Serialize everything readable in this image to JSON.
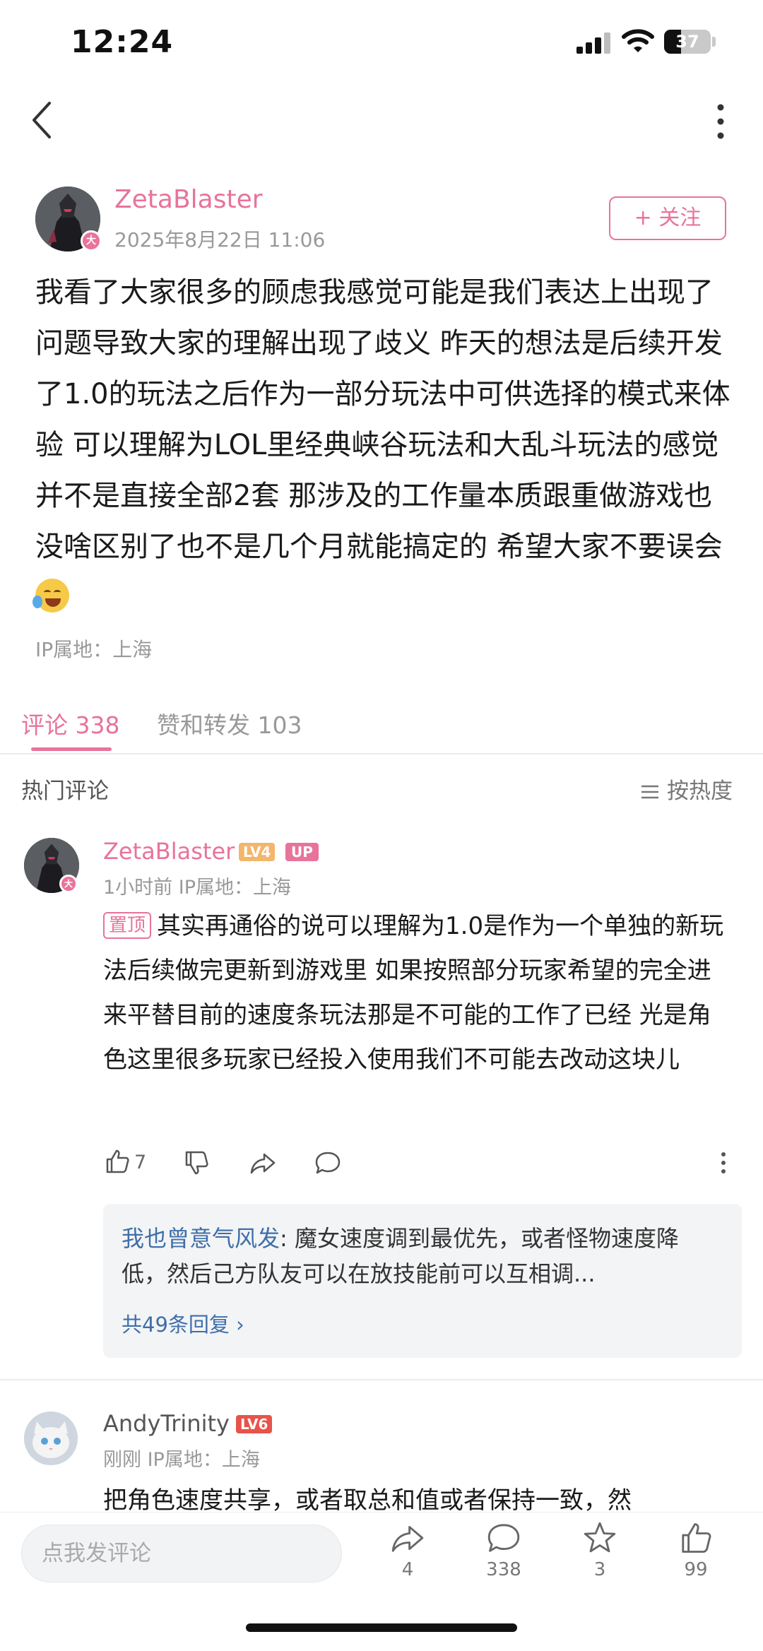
{
  "status_bar": {
    "time": "12:24",
    "battery": "37",
    "battery_level": 0.37
  },
  "post": {
    "author": "ZetaBlaster",
    "avatar_badge": "大",
    "date": "2025年8月22日 11:06",
    "follow_label": "+ 关注",
    "text": "我看了大家很多的顾虑我感觉可能是我们表达上出现了问题导致大家的理解出现了歧义 昨天的想法是后续开发了1.0的玩法之后作为一部分玩法中可供选择的模式来体验 可以理解为LOL里经典峡谷玩法和大乱斗玩法的感觉 并不是直接全部2套 那涉及的工作量本质跟重做游戏也没啥区别了也不是几个月就能搞定的 希望大家不要误会",
    "ip": "IP属地：上海"
  },
  "tabs": [
    {
      "label": "评论 338"
    },
    {
      "label": "赞和转发 103"
    }
  ],
  "comments_header": {
    "hot_label": "热门评论",
    "sort_label": "按热度"
  },
  "comments": [
    {
      "author": "ZetaBlaster",
      "avatar_badge": "大",
      "level": "LV4",
      "up_label": "UP",
      "meta": "1小时前  IP属地：上海",
      "pin_label": "置顶",
      "text": "其实再通俗的说可以理解为1.0是作为一个单独的新玩法后续做完更新到游戏里 如果按照部分玩家希望的完全进来平替目前的速度条玩法那是不可能的工作了已经 光是角色这里很多玩家已经投入使用我们不可能去改动这块儿",
      "like_count": "7",
      "reply": {
        "user": "我也曾意气风发",
        "text": ": 魔女速度调到最优先，或者怪物速度降低，然后己方队友可以在放技能前可以互相调...",
        "more_label": "共49条回复 ›"
      }
    },
    {
      "author": "AndyTrinity",
      "level": "LV6",
      "meta": "刚刚  IP属地：上海",
      "text": "把角色速度共享，或者取总和值或者保持一致，然"
    }
  ],
  "bottom_bar": {
    "input_placeholder": "点我发评论",
    "share_count": "4",
    "comment_count": "338",
    "star_count": "3",
    "like_count": "99"
  },
  "colors": {
    "accent": "#e8739b",
    "link": "#3f6fa8",
    "lv4": "#f3b66b",
    "lv6": "#e8534a"
  }
}
